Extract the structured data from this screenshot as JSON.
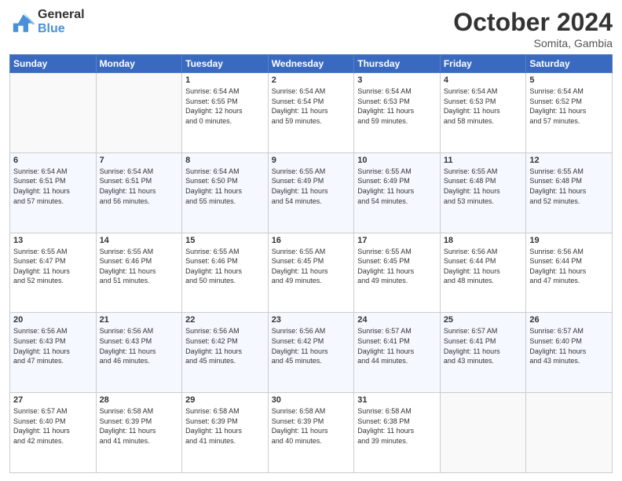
{
  "header": {
    "logo_line1": "General",
    "logo_line2": "Blue",
    "month": "October 2024",
    "location": "Somita, Gambia"
  },
  "weekdays": [
    "Sunday",
    "Monday",
    "Tuesday",
    "Wednesday",
    "Thursday",
    "Friday",
    "Saturday"
  ],
  "weeks": [
    [
      {
        "day": "",
        "info": ""
      },
      {
        "day": "",
        "info": ""
      },
      {
        "day": "1",
        "info": "Sunrise: 6:54 AM\nSunset: 6:55 PM\nDaylight: 12 hours\nand 0 minutes."
      },
      {
        "day": "2",
        "info": "Sunrise: 6:54 AM\nSunset: 6:54 PM\nDaylight: 11 hours\nand 59 minutes."
      },
      {
        "day": "3",
        "info": "Sunrise: 6:54 AM\nSunset: 6:53 PM\nDaylight: 11 hours\nand 59 minutes."
      },
      {
        "day": "4",
        "info": "Sunrise: 6:54 AM\nSunset: 6:53 PM\nDaylight: 11 hours\nand 58 minutes."
      },
      {
        "day": "5",
        "info": "Sunrise: 6:54 AM\nSunset: 6:52 PM\nDaylight: 11 hours\nand 57 minutes."
      }
    ],
    [
      {
        "day": "6",
        "info": "Sunrise: 6:54 AM\nSunset: 6:51 PM\nDaylight: 11 hours\nand 57 minutes."
      },
      {
        "day": "7",
        "info": "Sunrise: 6:54 AM\nSunset: 6:51 PM\nDaylight: 11 hours\nand 56 minutes."
      },
      {
        "day": "8",
        "info": "Sunrise: 6:54 AM\nSunset: 6:50 PM\nDaylight: 11 hours\nand 55 minutes."
      },
      {
        "day": "9",
        "info": "Sunrise: 6:55 AM\nSunset: 6:49 PM\nDaylight: 11 hours\nand 54 minutes."
      },
      {
        "day": "10",
        "info": "Sunrise: 6:55 AM\nSunset: 6:49 PM\nDaylight: 11 hours\nand 54 minutes."
      },
      {
        "day": "11",
        "info": "Sunrise: 6:55 AM\nSunset: 6:48 PM\nDaylight: 11 hours\nand 53 minutes."
      },
      {
        "day": "12",
        "info": "Sunrise: 6:55 AM\nSunset: 6:48 PM\nDaylight: 11 hours\nand 52 minutes."
      }
    ],
    [
      {
        "day": "13",
        "info": "Sunrise: 6:55 AM\nSunset: 6:47 PM\nDaylight: 11 hours\nand 52 minutes."
      },
      {
        "day": "14",
        "info": "Sunrise: 6:55 AM\nSunset: 6:46 PM\nDaylight: 11 hours\nand 51 minutes."
      },
      {
        "day": "15",
        "info": "Sunrise: 6:55 AM\nSunset: 6:46 PM\nDaylight: 11 hours\nand 50 minutes."
      },
      {
        "day": "16",
        "info": "Sunrise: 6:55 AM\nSunset: 6:45 PM\nDaylight: 11 hours\nand 49 minutes."
      },
      {
        "day": "17",
        "info": "Sunrise: 6:55 AM\nSunset: 6:45 PM\nDaylight: 11 hours\nand 49 minutes."
      },
      {
        "day": "18",
        "info": "Sunrise: 6:56 AM\nSunset: 6:44 PM\nDaylight: 11 hours\nand 48 minutes."
      },
      {
        "day": "19",
        "info": "Sunrise: 6:56 AM\nSunset: 6:44 PM\nDaylight: 11 hours\nand 47 minutes."
      }
    ],
    [
      {
        "day": "20",
        "info": "Sunrise: 6:56 AM\nSunset: 6:43 PM\nDaylight: 11 hours\nand 47 minutes."
      },
      {
        "day": "21",
        "info": "Sunrise: 6:56 AM\nSunset: 6:43 PM\nDaylight: 11 hours\nand 46 minutes."
      },
      {
        "day": "22",
        "info": "Sunrise: 6:56 AM\nSunset: 6:42 PM\nDaylight: 11 hours\nand 45 minutes."
      },
      {
        "day": "23",
        "info": "Sunrise: 6:56 AM\nSunset: 6:42 PM\nDaylight: 11 hours\nand 45 minutes."
      },
      {
        "day": "24",
        "info": "Sunrise: 6:57 AM\nSunset: 6:41 PM\nDaylight: 11 hours\nand 44 minutes."
      },
      {
        "day": "25",
        "info": "Sunrise: 6:57 AM\nSunset: 6:41 PM\nDaylight: 11 hours\nand 43 minutes."
      },
      {
        "day": "26",
        "info": "Sunrise: 6:57 AM\nSunset: 6:40 PM\nDaylight: 11 hours\nand 43 minutes."
      }
    ],
    [
      {
        "day": "27",
        "info": "Sunrise: 6:57 AM\nSunset: 6:40 PM\nDaylight: 11 hours\nand 42 minutes."
      },
      {
        "day": "28",
        "info": "Sunrise: 6:58 AM\nSunset: 6:39 PM\nDaylight: 11 hours\nand 41 minutes."
      },
      {
        "day": "29",
        "info": "Sunrise: 6:58 AM\nSunset: 6:39 PM\nDaylight: 11 hours\nand 41 minutes."
      },
      {
        "day": "30",
        "info": "Sunrise: 6:58 AM\nSunset: 6:39 PM\nDaylight: 11 hours\nand 40 minutes."
      },
      {
        "day": "31",
        "info": "Sunrise: 6:58 AM\nSunset: 6:38 PM\nDaylight: 11 hours\nand 39 minutes."
      },
      {
        "day": "",
        "info": ""
      },
      {
        "day": "",
        "info": ""
      }
    ]
  ]
}
